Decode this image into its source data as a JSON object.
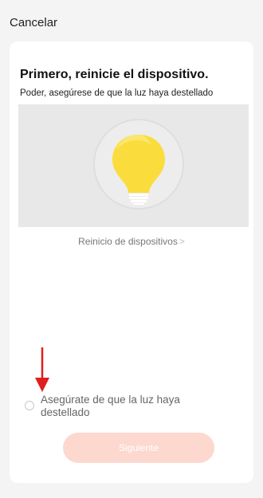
{
  "header": {
    "cancel_label": "Cancelar"
  },
  "card": {
    "title": "Primero, reinicie el dispositivo.",
    "subtitle": "Poder, asegúrese de que la luz haya destellado",
    "illustration_icon": "lightbulb-icon",
    "reset_link_label": "Reinicio de dispositivos",
    "reset_link_chevron": ">",
    "confirm_label": "Asegúrate de que la luz haya destellado",
    "next_label": "Siguiente"
  },
  "colors": {
    "page_bg": "#f4f4f4",
    "card_bg": "#ffffff",
    "bulb_yellow": "#fadd3c",
    "button_bg": "#fcd8cf",
    "arrow_red": "#e01e1e"
  }
}
